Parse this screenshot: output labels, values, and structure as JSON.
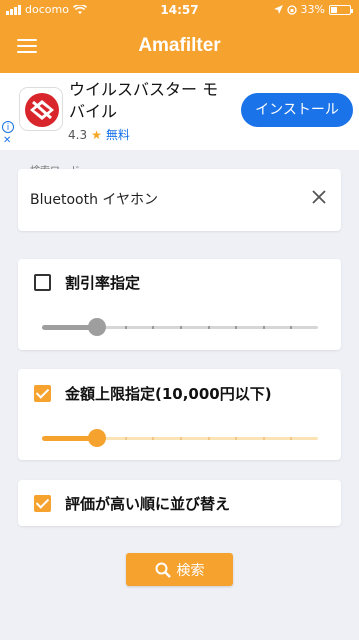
{
  "status_bar": {
    "carrier": "docomo",
    "time": "14:57",
    "battery": "33%",
    "battery_level": 0.33
  },
  "header": {
    "title": "Amafilter"
  },
  "ad": {
    "title": "ウイルスバスター モバイル",
    "rating": "4.3",
    "price": "無料",
    "install_label": "インストール"
  },
  "search": {
    "label": "検索ワード",
    "value": "Bluetooth イヤホン"
  },
  "filters": {
    "discount": {
      "label": "割引率指定",
      "checked": false,
      "slider_fraction": 0.2
    },
    "max_price": {
      "label": "金額上限指定(10,000円以下)",
      "checked": true,
      "slider_fraction": 0.2
    },
    "sort_rating": {
      "label": "評価が高い順に並び替え",
      "checked": true
    }
  },
  "submit": {
    "label": "検索"
  },
  "colors": {
    "accent": "#f5a22f",
    "accent_light": "#fbe3b6",
    "ad_blue": "#1a73e8",
    "disabled": "#9e9e9e"
  }
}
